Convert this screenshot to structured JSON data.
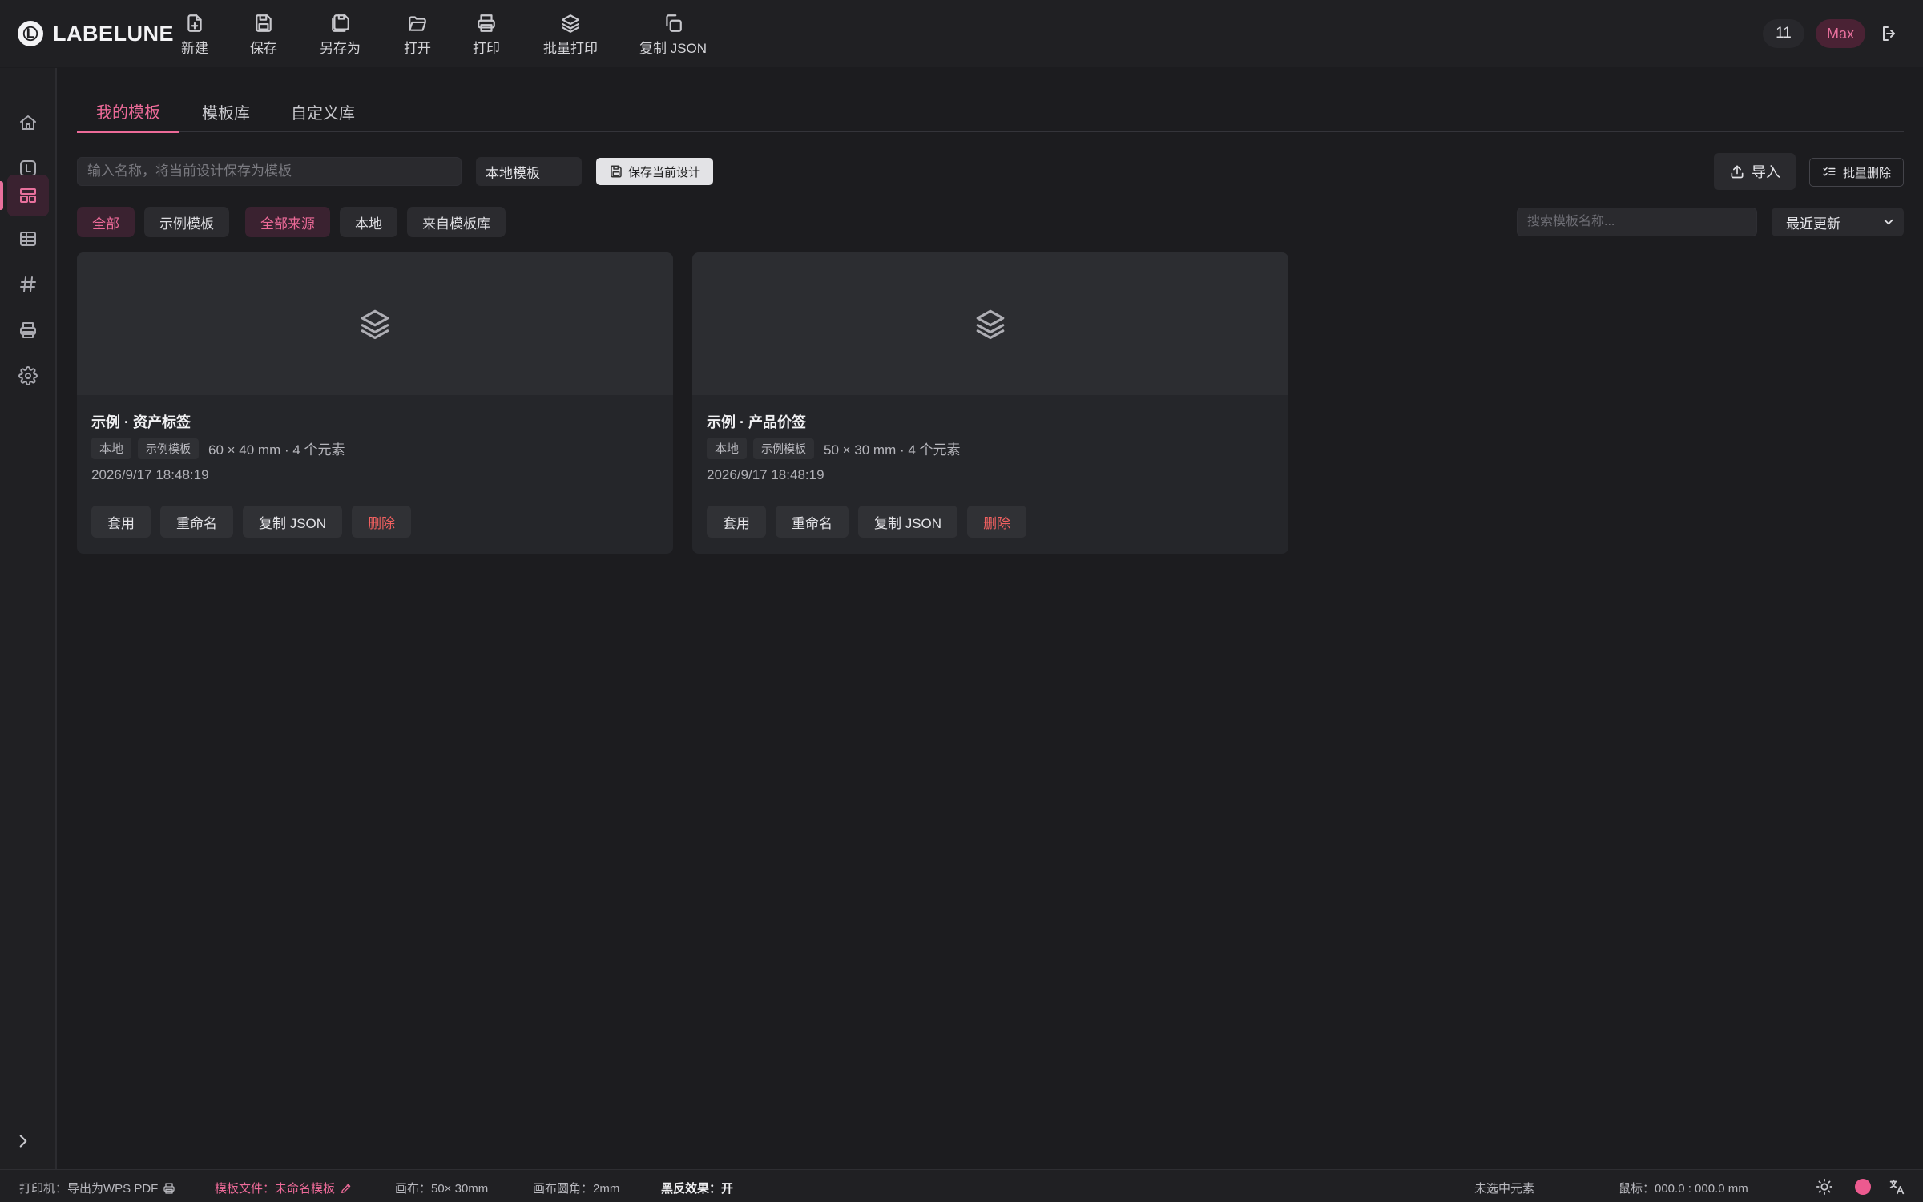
{
  "app": {
    "name": "LABELUNE"
  },
  "toolbar": [
    {
      "label": "新建",
      "icon": "file-plus-icon"
    },
    {
      "label": "保存",
      "icon": "save-icon"
    },
    {
      "label": "另存为",
      "icon": "save-as-icon"
    },
    {
      "label": "打开",
      "icon": "folder-open-icon"
    },
    {
      "label": "打印",
      "icon": "printer-icon"
    },
    {
      "label": "批量打印",
      "icon": "layers-icon"
    },
    {
      "label": "复制 JSON",
      "icon": "copy-icon"
    }
  ],
  "header": {
    "counter": "11",
    "user": "Max"
  },
  "sidebar": {
    "items": [
      {
        "icon": "home-icon",
        "active": false
      },
      {
        "icon": "label-icon",
        "active": false
      },
      {
        "icon": "templates-icon",
        "active": true
      },
      {
        "icon": "table-icon",
        "active": false
      },
      {
        "icon": "hash-icon",
        "active": false
      },
      {
        "icon": "printer-icon",
        "active": false
      },
      {
        "icon": "gear-icon",
        "active": false
      }
    ]
  },
  "tabs": [
    {
      "label": "我的模板",
      "active": true
    },
    {
      "label": "模板库",
      "active": false
    },
    {
      "label": "自定义库",
      "active": false
    }
  ],
  "save_bar": {
    "name_placeholder": "输入名称，将当前设计保存为模板",
    "scope": "本地模板",
    "save_current": "保存当前设计"
  },
  "actions": {
    "import": "导入",
    "batch_delete": "批量删除"
  },
  "filters": {
    "type": [
      {
        "label": "全部",
        "active": true
      },
      {
        "label": "示例模板",
        "active": false
      }
    ],
    "source": [
      {
        "label": "全部来源",
        "active": true
      },
      {
        "label": "本地",
        "active": false
      },
      {
        "label": "来自模板库",
        "active": false
      }
    ],
    "search_placeholder": "搜索模板名称...",
    "sort": "最近更新"
  },
  "templates": [
    {
      "title": "示例 · 资产标签",
      "tags": [
        "本地",
        "示例模板"
      ],
      "dims": "60 × 40 mm · 4 个元素",
      "date": "2026/9/17 18:48:19",
      "buttons": {
        "apply": "套用",
        "rename": "重命名",
        "copy": "复制 JSON",
        "delete": "删除"
      }
    },
    {
      "title": "示例 · 产品价签",
      "tags": [
        "本地",
        "示例模板"
      ],
      "dims": "50 × 30 mm · 4 个元素",
      "date": "2026/9/17 18:48:19",
      "buttons": {
        "apply": "套用",
        "rename": "重命名",
        "copy": "复制 JSON",
        "delete": "删除"
      }
    }
  ],
  "status": {
    "printer": "打印机：导出为WPS PDF",
    "template_file": "模板文件：未命名模板",
    "canvas": "画布：50× 30mm",
    "corner": "画布圆角：2mm",
    "invert": "黑反效果：开",
    "selection": "未选中元素",
    "cursor": "鼠标：000.0 : 000.0 mm"
  },
  "colors": {
    "accent": "#ec6a98",
    "danger": "#f06060",
    "background": "#1c1c1f",
    "panel": "#202023"
  }
}
